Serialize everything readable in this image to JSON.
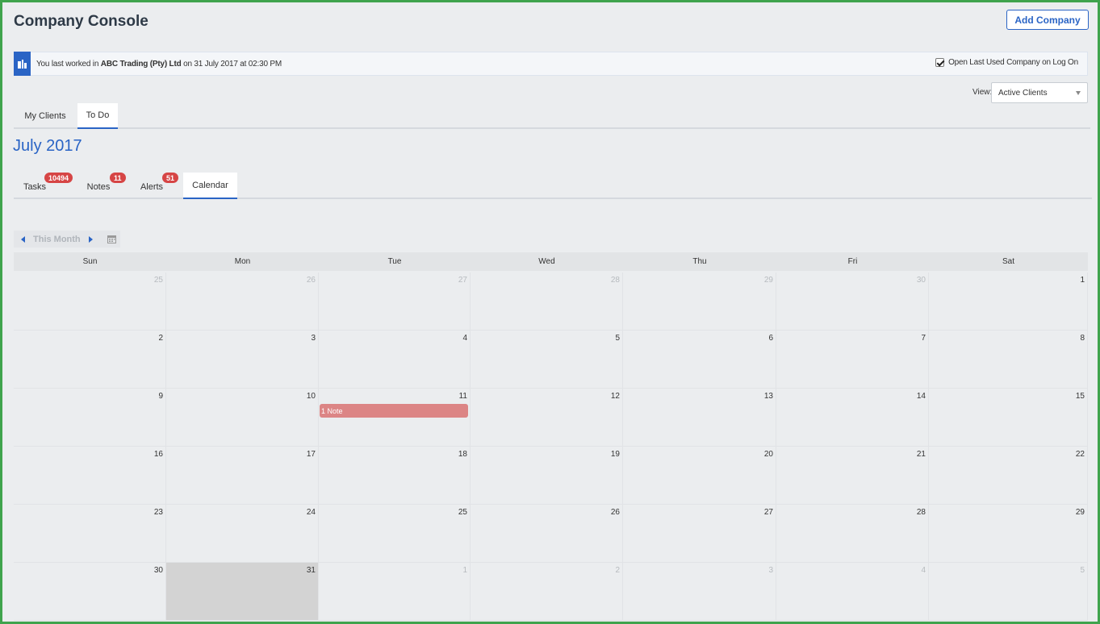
{
  "header": {
    "title": "Company Console",
    "add_company_label": "Add Company"
  },
  "info_bar": {
    "icon": "company-building-icon",
    "prefix": "You last worked in",
    "company": "ABC Trading (Pty) Ltd",
    "suffix": "on 31 July 2017 at 02:30 PM",
    "open_last_label": "Open Last Used Company on Log On",
    "open_last_checked": true
  },
  "view": {
    "label": "View:",
    "selected": "Active Clients"
  },
  "main_tabs": [
    {
      "label": "My Clients",
      "active": false
    },
    {
      "label": "To Do",
      "active": true
    }
  ],
  "month_heading": "July 2017",
  "todo_tabs": [
    {
      "label": "Tasks",
      "badge": "10494",
      "active": false
    },
    {
      "label": "Notes",
      "badge": "11",
      "active": false
    },
    {
      "label": "Alerts",
      "badge": "51",
      "active": false
    },
    {
      "label": "Calendar",
      "badge": "",
      "active": true
    }
  ],
  "calendar": {
    "nav_label": "This Month",
    "weekdays": [
      "Sun",
      "Mon",
      "Tue",
      "Wed",
      "Thu",
      "Fri",
      "Sat"
    ],
    "weeks": [
      [
        {
          "d": "25",
          "other": true
        },
        {
          "d": "26",
          "other": true
        },
        {
          "d": "27",
          "other": true
        },
        {
          "d": "28",
          "other": true
        },
        {
          "d": "29",
          "other": true
        },
        {
          "d": "30",
          "other": true
        },
        {
          "d": "1",
          "other": false
        }
      ],
      [
        {
          "d": "2",
          "other": false
        },
        {
          "d": "3",
          "other": false
        },
        {
          "d": "4",
          "other": false
        },
        {
          "d": "5",
          "other": false
        },
        {
          "d": "6",
          "other": false
        },
        {
          "d": "7",
          "other": false
        },
        {
          "d": "8",
          "other": false
        }
      ],
      [
        {
          "d": "9",
          "other": false
        },
        {
          "d": "10",
          "other": false
        },
        {
          "d": "11",
          "other": false,
          "event": "1 Note"
        },
        {
          "d": "12",
          "other": false
        },
        {
          "d": "13",
          "other": false
        },
        {
          "d": "14",
          "other": false
        },
        {
          "d": "15",
          "other": false
        }
      ],
      [
        {
          "d": "16",
          "other": false
        },
        {
          "d": "17",
          "other": false
        },
        {
          "d": "18",
          "other": false
        },
        {
          "d": "19",
          "other": false
        },
        {
          "d": "20",
          "other": false
        },
        {
          "d": "21",
          "other": false
        },
        {
          "d": "22",
          "other": false
        }
      ],
      [
        {
          "d": "23",
          "other": false
        },
        {
          "d": "24",
          "other": false
        },
        {
          "d": "25",
          "other": false
        },
        {
          "d": "26",
          "other": false
        },
        {
          "d": "27",
          "other": false
        },
        {
          "d": "28",
          "other": false
        },
        {
          "d": "29",
          "other": false
        }
      ],
      [
        {
          "d": "30",
          "other": false
        },
        {
          "d": "31",
          "other": false,
          "today": true
        },
        {
          "d": "1",
          "other": true
        },
        {
          "d": "2",
          "other": true
        },
        {
          "d": "3",
          "other": true
        },
        {
          "d": "4",
          "other": true
        },
        {
          "d": "5",
          "other": true
        }
      ]
    ],
    "event_color": "#dc8585",
    "today_color": "#d3d3d3"
  },
  "colors": {
    "accent": "#2a64c5",
    "badge": "#d64545",
    "frame": "#3fa34d"
  }
}
